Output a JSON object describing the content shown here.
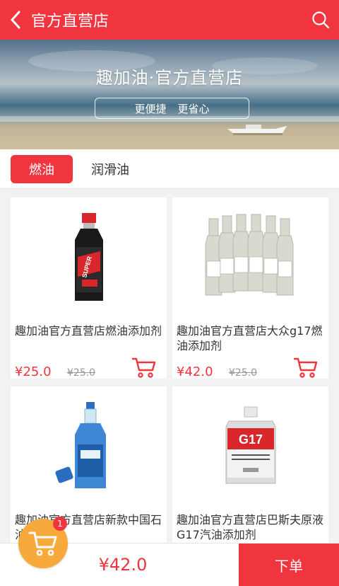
{
  "header": {
    "title": "官方直营店",
    "back_icon": "chevron-left-icon",
    "search_icon": "search-icon"
  },
  "banner": {
    "title": "趣加油·官方直营店",
    "tag1": "更便捷",
    "tag2": "更省心"
  },
  "tabs": [
    {
      "label": "燃油",
      "active": true
    },
    {
      "label": "润滑油",
      "active": false
    }
  ],
  "products": [
    {
      "name": "趣加油官方直营店燃油添加剂",
      "price": "¥25.0",
      "original_price": "¥25.0",
      "image": "red-black-bottle"
    },
    {
      "name": "趣加油官方直营店大众g17燃油添加剂",
      "price": "¥42.0",
      "original_price": "¥25.0",
      "image": "six-bottles"
    },
    {
      "name": "趣加油官方直营店新款中国石油添加剂",
      "price": "",
      "original_price": "",
      "image": "blue-bottle"
    },
    {
      "name": "趣加油官方直营店巴斯夫原液G17汽油添加剂",
      "price": "",
      "original_price": "",
      "image": "g17-can"
    }
  ],
  "bottom": {
    "total": "¥42.0",
    "order_label": "下单",
    "cart_count": "1"
  },
  "colors": {
    "accent": "#f1353e",
    "cart_float": "#f7a93c"
  }
}
